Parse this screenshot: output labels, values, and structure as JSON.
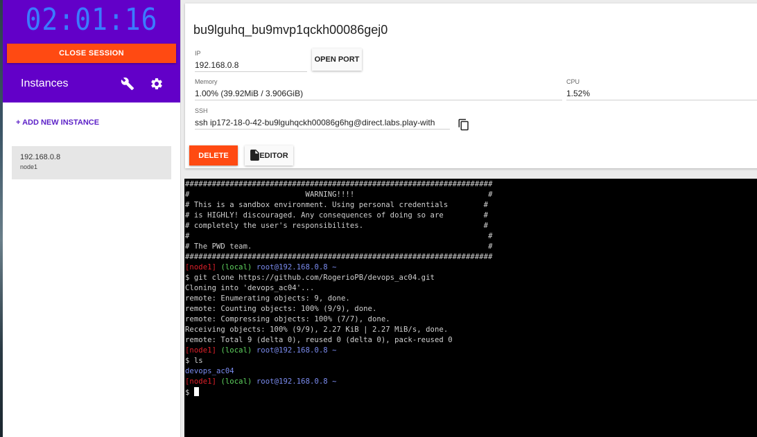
{
  "sidebar": {
    "timer": "02:01:16",
    "close_session_label": "CLOSE SESSION",
    "instances_title": "Instances",
    "add_instance_label": "+ ADD NEW INSTANCE",
    "instances": [
      {
        "ip": "192.168.0.8",
        "name": "node1"
      }
    ]
  },
  "instance": {
    "title": "bu9lguhq_bu9mvp1qckh00086gej0",
    "ip_label": "IP",
    "ip_value": "192.168.0.8",
    "open_port_label": "OPEN PORT",
    "memory_label": "Memory",
    "memory_value": "1.00% (39.92MiB / 3.906GiB)",
    "cpu_label": "CPU",
    "cpu_value": "1.52%",
    "ssh_label": "SSH",
    "ssh_value": "ssh ip172-18-0-42-bu9lguhqckh00086g6hg@direct.labs.play-with",
    "delete_label": "DELETE",
    "editor_label": "EDITOR"
  },
  "terminal": {
    "banner": [
      "#####################################################################",
      "#                          WARNING!!!!                              #",
      "# This is a sandbox environment. Using personal credentials        #",
      "# is HIGHLY! discouraged. Any consequences of doing so are         #",
      "# completely the user's responsibilites.                           #",
      "#                                                                   #",
      "# The PWD team.                                                     #",
      "#####################################################################"
    ],
    "prompt": {
      "node": "[node1]",
      "local": "(local)",
      "user_host": "root@192.168.0.8",
      "dir": "~"
    },
    "cmd1": "$ git clone https://github.com/RogerioPB/devops_ac04.git",
    "clone_output": [
      "Cloning into 'devops_ac04'...",
      "remote: Enumerating objects: 9, done.",
      "remote: Counting objects: 100% (9/9), done.",
      "remote: Compressing objects: 100% (7/7), done.",
      "Receiving objects: 100% (9/9), 2.27 KiB | 2.27 MiB/s, done.",
      "remote: Total 9 (delta 0), reused 0 (delta 0), pack-reused 0"
    ],
    "cmd2": "$ ls",
    "ls_output": "devops_ac04",
    "final_prompt_symbol": "$ "
  },
  "icons": {
    "wrench": "wrench-icon",
    "gear": "gear-icon",
    "copy": "copy-icon",
    "file": "file-icon"
  },
  "colors": {
    "sidebar_header": "#6200c8",
    "timer": "#3b7bff",
    "danger_button": "#ff4a12",
    "accent_link": "#5b1fc7",
    "prompt_node": "#e0202a",
    "prompt_local": "#5fd35f",
    "prompt_host": "#7b8cf0"
  }
}
